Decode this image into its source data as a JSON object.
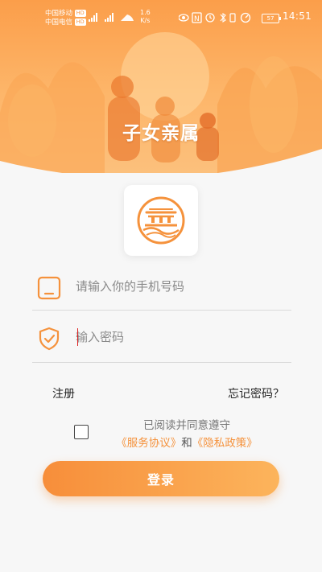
{
  "status_bar": {
    "carrier_1": "中国移动",
    "carrier_2": "中国电信",
    "hd_badge": "HD",
    "network_speed_value": "1.6",
    "network_speed_unit": "K/s",
    "battery": "57",
    "time": "14:51",
    "signal_label": "4G"
  },
  "header": {
    "title": "子女亲属",
    "background_colors": [
      "#fb9e4a",
      "#fdb66a",
      "#fcc07c"
    ]
  },
  "logo": {
    "icon": "app-logo-icon"
  },
  "form": {
    "phone_placeholder": "请输入你的手机号码",
    "phone_icon": "phone-icon",
    "password_placeholder": "输入密码",
    "password_icon": "shield-check-icon"
  },
  "links": {
    "register": "注册",
    "forgot_password": "忘记密码？"
  },
  "agreement": {
    "checked": false,
    "line1": "已阅读并同意遵守",
    "service": "《服务协议》",
    "and": "和",
    "privacy": "《隐私政策》"
  },
  "login_button": "登录",
  "colors": {
    "accent": "#f5923c",
    "button_gradient": [
      "#f78e3a",
      "#fcb45c"
    ]
  }
}
